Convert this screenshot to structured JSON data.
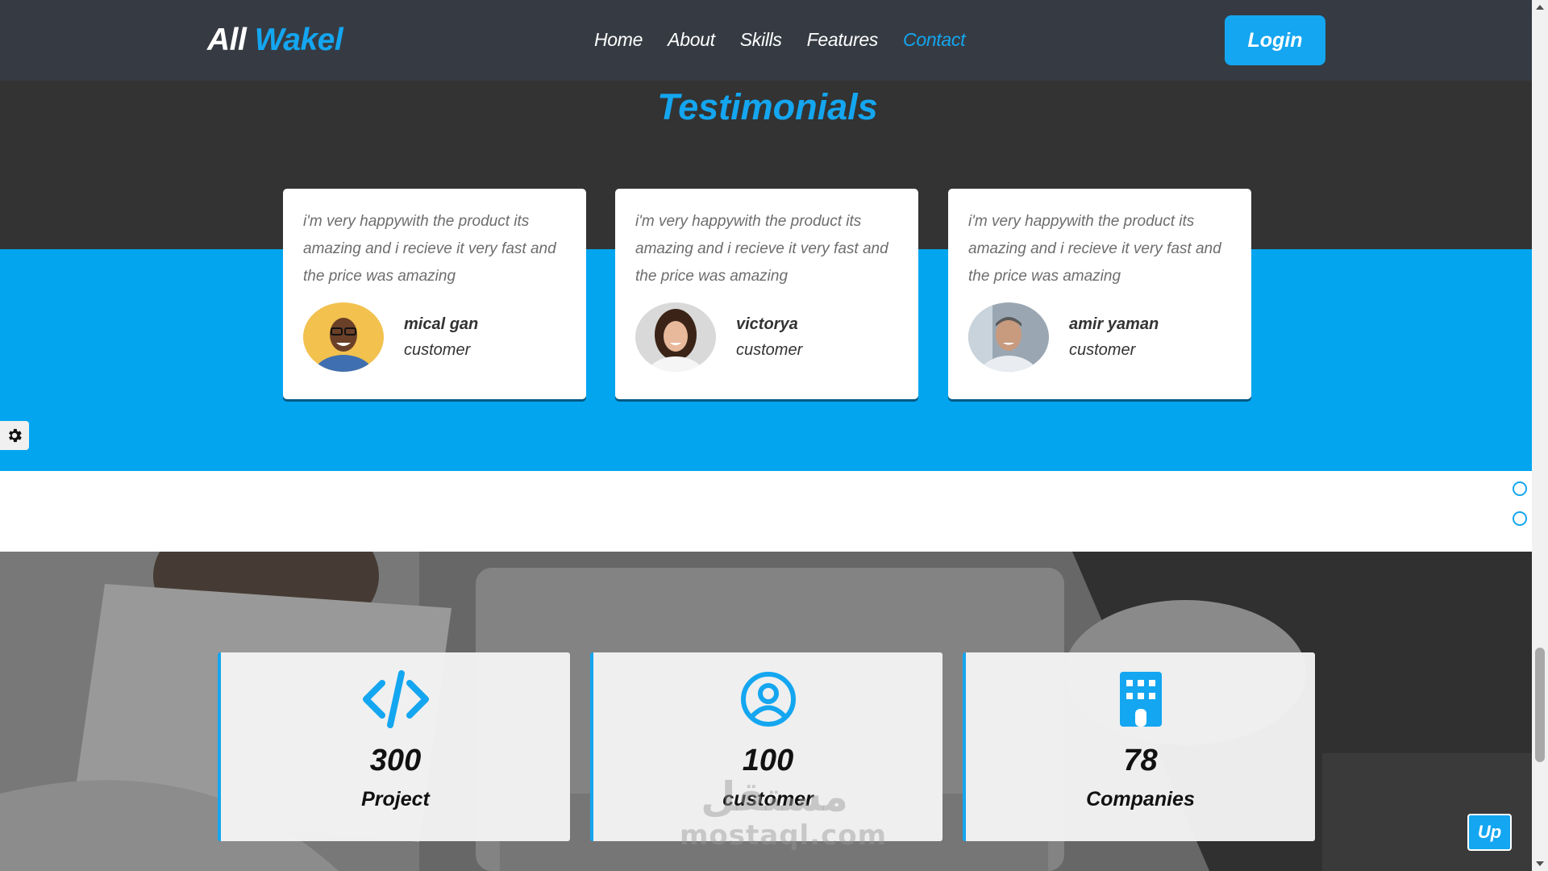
{
  "header": {
    "logo_first": "All",
    "logo_second": "Wakel",
    "nav": [
      {
        "label": "Home",
        "active": false
      },
      {
        "label": "About",
        "active": false
      },
      {
        "label": "Skills",
        "active": false
      },
      {
        "label": "Features",
        "active": false
      },
      {
        "label": "Contact",
        "active": true
      }
    ],
    "login_label": "Login"
  },
  "testimonials": {
    "title": "Testimonials",
    "cards": [
      {
        "quote": "i'm very happywith the product its amazing and i recieve it very fast and the price was amazing",
        "name": "mical gan",
        "role": "customer"
      },
      {
        "quote": "i'm very happywith the product its amazing and i recieve it very fast and the price was amazing",
        "name": "victorya",
        "role": "customer"
      },
      {
        "quote": "i'm very happywith the product its amazing and i recieve it very fast and the price was amazing",
        "name": "amir yaman",
        "role": "customer"
      }
    ]
  },
  "stats": [
    {
      "icon": "code-icon",
      "value": "300",
      "label": "Project"
    },
    {
      "icon": "user-circle-icon",
      "value": "100",
      "label": "customer"
    },
    {
      "icon": "building-icon",
      "value": "78",
      "label": "Companies"
    }
  ],
  "watermark": {
    "arabic": "مستقل",
    "latin": "mostaql.com"
  },
  "up_label": "Up",
  "icons": {
    "settings": "gear-icon"
  },
  "colors": {
    "accent": "#14a6f0",
    "header": "#363b43",
    "dark_band": "#333333",
    "blue_band": "#03a5ef"
  }
}
